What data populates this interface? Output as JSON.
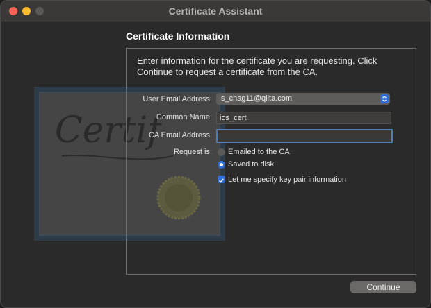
{
  "window": {
    "title": "Certificate Assistant"
  },
  "page": {
    "heading": "Certificate Information",
    "intro": "Enter information for the certificate you are requesting. Click Continue to request a certificate from the CA."
  },
  "form": {
    "user_email_label": "User Email Address:",
    "user_email_value": "s_chag11@qiita.com",
    "common_name_label": "Common Name:",
    "common_name_value": "ios_cert",
    "ca_email_label": "CA Email Address:",
    "ca_email_value": "",
    "request_is_label": "Request is:",
    "options": [
      {
        "label": "Emailed to the CA",
        "selected": false
      },
      {
        "label": "Saved to disk",
        "selected": true
      }
    ],
    "key_pair_checkbox_label": "Let me specify key pair information",
    "key_pair_checked": true
  },
  "buttons": {
    "continue_label": "Continue"
  },
  "decoration": {
    "certificate_word": "Certif"
  },
  "colors": {
    "accent": "#2f6cd6",
    "close": "#ff5f57",
    "minimize": "#febc2e"
  }
}
